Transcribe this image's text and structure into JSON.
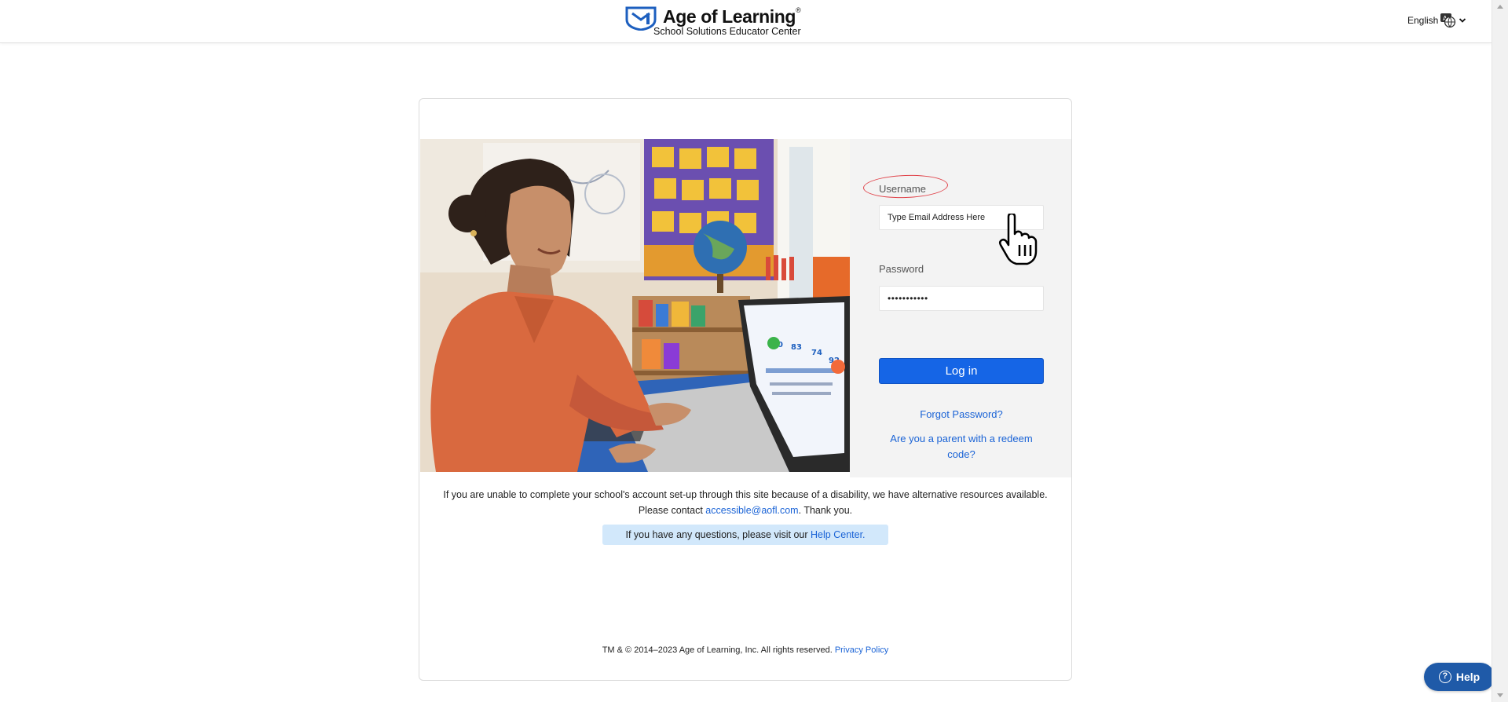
{
  "header": {
    "brand_name": "Age of Learning",
    "brand_registered": "®",
    "brand_subtitle": "School Solutions Educator Center",
    "language": "English"
  },
  "hero": {
    "dashboard_values": [
      "90",
      "83",
      "74",
      "92"
    ]
  },
  "login": {
    "username_label": "Username",
    "username_placeholder": "Type Email Address Here",
    "password_label": "Password",
    "password_value": "•••••••••••",
    "login_button": "Log in",
    "forgot_password": "Forgot Password?",
    "parent_redeem": "Are you a parent with a redeem code?"
  },
  "notice": {
    "line1": "If you are unable to complete your school's account set-up through this site because of a disability, we have alternative resources available.",
    "line2_prefix": "Please contact ",
    "email": "accessible@aofl.com",
    "line2_suffix": ". Thank you."
  },
  "help_banner": {
    "prefix": "If you have any questions, please visit our ",
    "link": "Help Center."
  },
  "footer": {
    "copyright": "TM & © 2014–2023 Age of Learning, Inc. All rights reserved. ",
    "privacy": "Privacy Policy"
  },
  "help_button": {
    "label": "Help",
    "icon": "?"
  },
  "colors": {
    "primary": "#1565e6",
    "link": "#1a63d6",
    "banner": "#d2e8fb",
    "help_fab": "#1f5aa8",
    "highlight": "#e0434a"
  }
}
